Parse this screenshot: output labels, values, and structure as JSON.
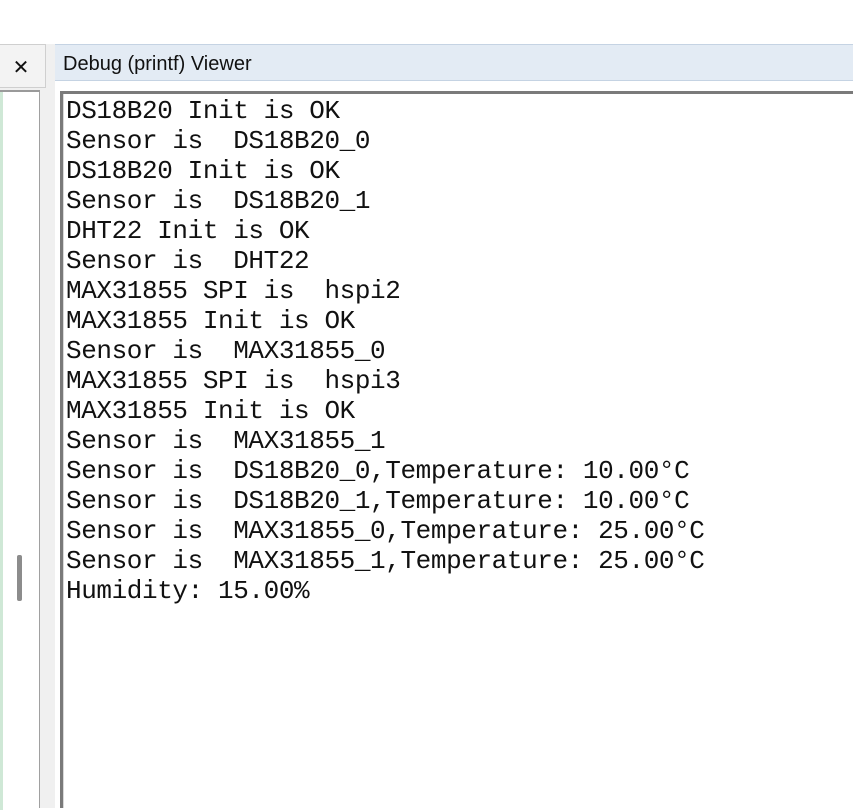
{
  "left_pane": {
    "close_icon": "close-icon",
    "close_glyph": "✕"
  },
  "debug_viewer": {
    "title": "Debug (printf) Viewer",
    "lines": [
      "DS18B20 Init is OK",
      "Sensor is  DS18B20_0",
      "DS18B20 Init is OK",
      "Sensor is  DS18B20_1",
      "DHT22 Init is OK",
      "Sensor is  DHT22",
      "MAX31855 SPI is  hspi2",
      "MAX31855 Init is OK",
      "Sensor is  MAX31855_0",
      "MAX31855 SPI is  hspi3",
      "MAX31855 Init is OK",
      "Sensor is  MAX31855_1",
      "Sensor is  DS18B20_0,Temperature: 10.00°C",
      "Sensor is  DS18B20_1,Temperature: 10.00°C",
      "Sensor is  MAX31855_0,Temperature: 25.00°C",
      "Sensor is  MAX31855_1,Temperature: 25.00°C",
      "Humidity: 15.00%"
    ]
  },
  "colors": {
    "title_bar_bg": "#e3ebf4",
    "output_text": "#111111",
    "pane_bg": "#f0f0f0"
  }
}
